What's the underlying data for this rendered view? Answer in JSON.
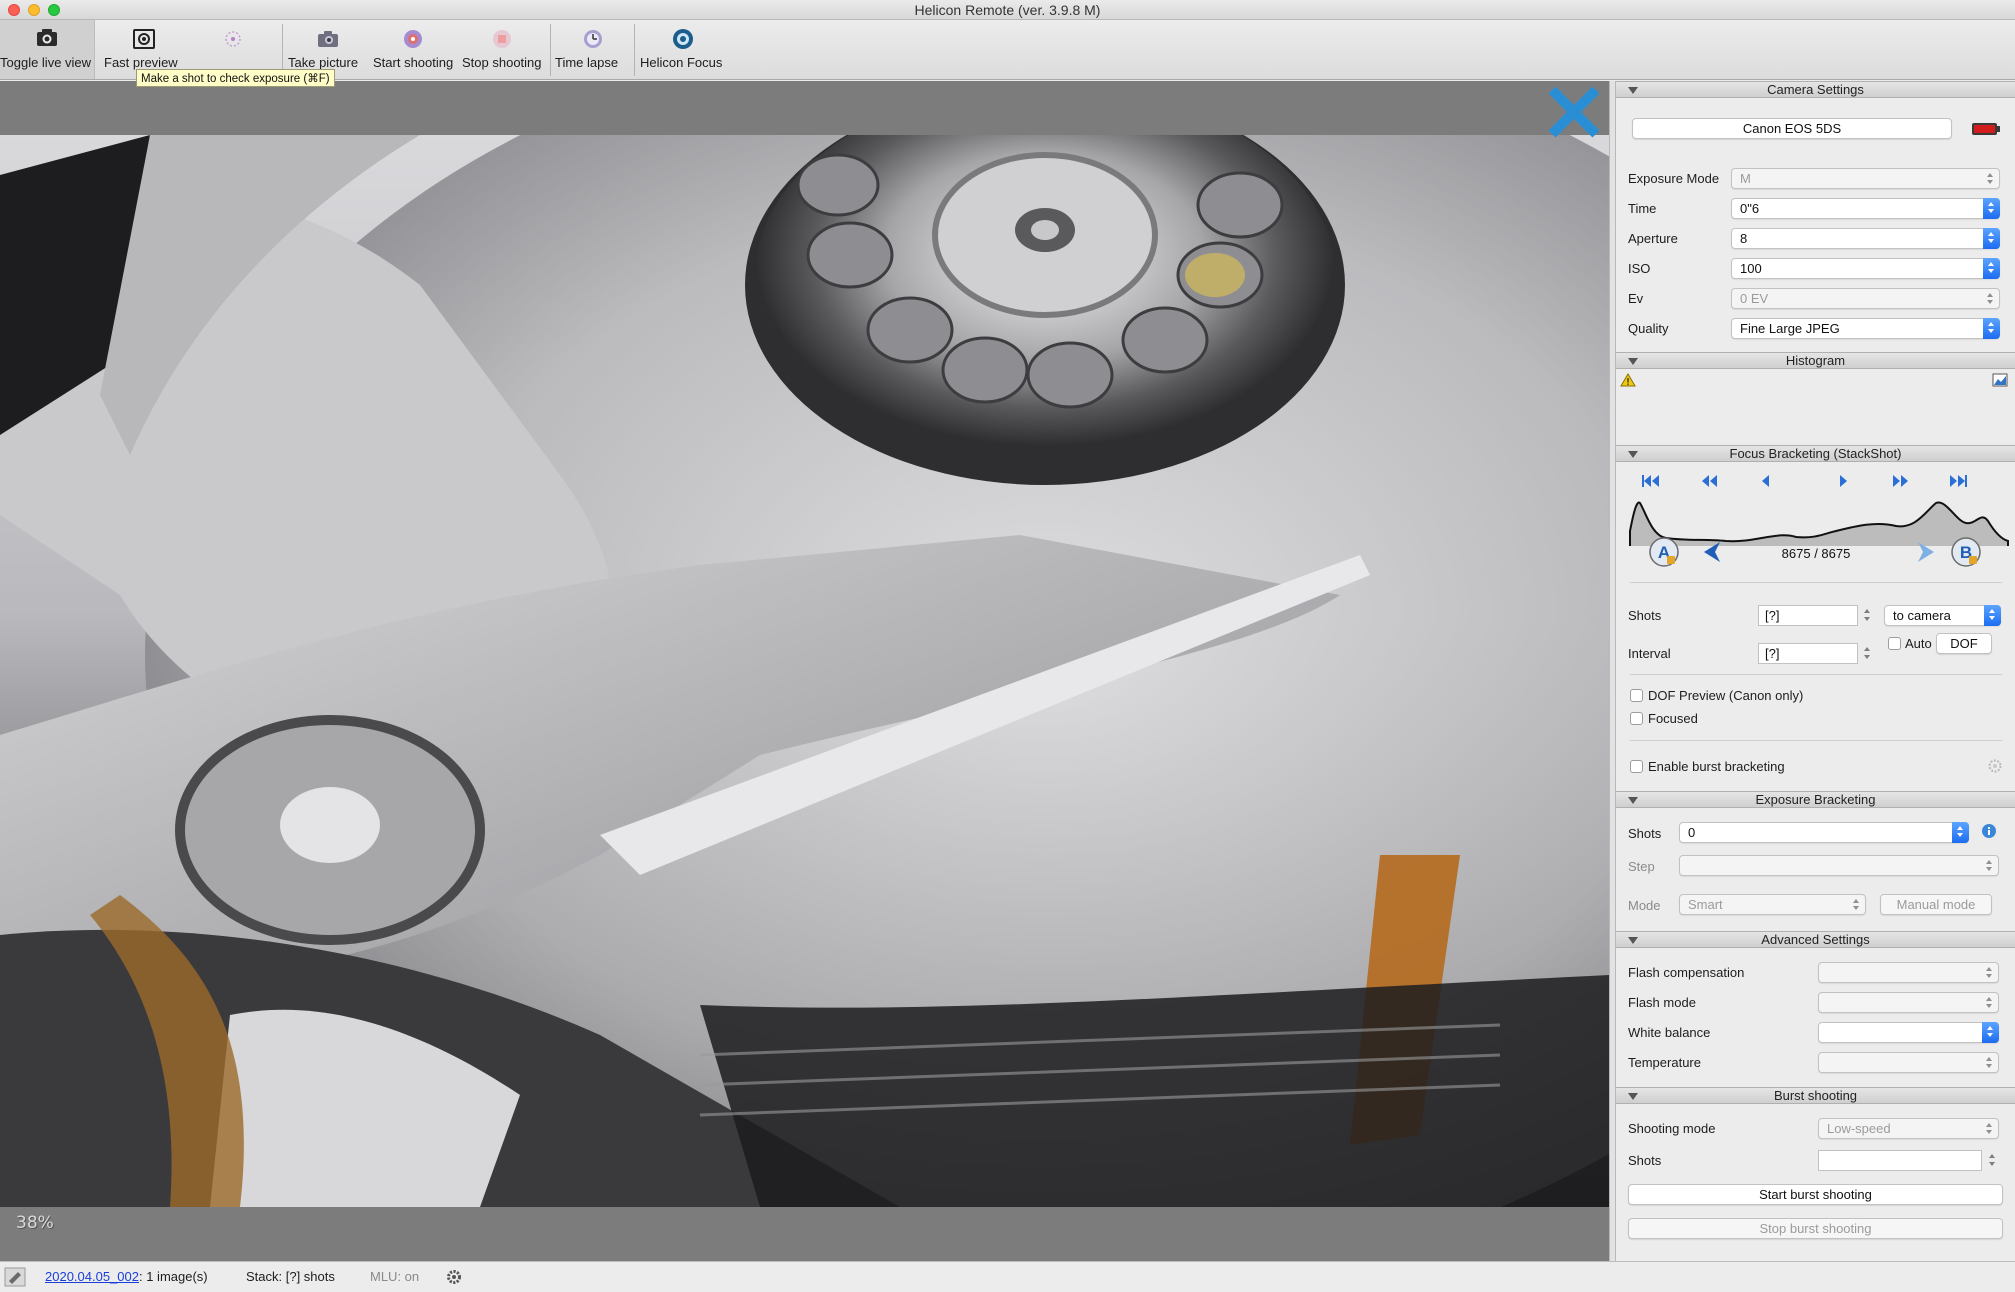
{
  "window": {
    "title": "Helicon Remote (ver. 3.9.8 M)"
  },
  "toolbar": {
    "toggle_live_view": "Toggle live view",
    "fast_preview": "Fast preview",
    "take_picture": "Take picture",
    "start_shooting": "Start shooting",
    "stop_shooting": "Stop shooting",
    "time_lapse": "Time lapse",
    "helicon_focus": "Helicon Focus",
    "tooltip": "Make a shot to check exposure (⌘F)"
  },
  "viewer": {
    "zoom": "38%"
  },
  "camera_settings": {
    "header": "Camera Settings",
    "camera_name": "Canon EOS 5DS",
    "exposure_mode_label": "Exposure Mode",
    "exposure_mode_value": "M",
    "time_label": "Time",
    "time_value": "0\"6",
    "aperture_label": "Aperture",
    "aperture_value": "8",
    "iso_label": "ISO",
    "iso_value": "100",
    "ev_label": "Ev",
    "ev_value": "0 EV",
    "quality_label": "Quality",
    "quality_value": "Fine Large JPEG"
  },
  "histogram": {
    "header": "Histogram"
  },
  "focus_bracketing": {
    "header": "Focus Bracketing (StackShot)",
    "counter": "8675 / 8675",
    "shots_label": "Shots",
    "shots_value": "[?]",
    "destination_value": "to camera",
    "interval_label": "Interval",
    "interval_value": "[?]",
    "auto_label": "Auto",
    "dof_button": "DOF",
    "dof_preview_label": "DOF Preview (Canon only)",
    "focused_label": "Focused",
    "burst_label": "Enable burst bracketing",
    "point_a": "A",
    "point_b": "B"
  },
  "exposure_bracketing": {
    "header": "Exposure Bracketing",
    "shots_label": "Shots",
    "shots_value": "0",
    "step_label": "Step",
    "mode_label": "Mode",
    "mode_value": "Smart",
    "manual_mode_button": "Manual mode"
  },
  "advanced_settings": {
    "header": "Advanced Settings",
    "flash_compensation_label": "Flash compensation",
    "flash_mode_label": "Flash mode",
    "white_balance_label": "White balance",
    "temperature_label": "Temperature"
  },
  "burst_shooting": {
    "header": "Burst shooting",
    "shooting_mode_label": "Shooting mode",
    "shooting_mode_value": "Low-speed",
    "shots_label": "Shots",
    "start_button": "Start burst shooting",
    "stop_button": "Stop burst shooting"
  },
  "statusbar": {
    "session_link": "2020.04.05_002",
    "images_text": ": 1 image(s)",
    "stack_text": "Stack: [?] shots",
    "mlu_text": "MLU: on"
  },
  "colors": {
    "accent_blue": "#1b6cf0",
    "close_blue": "#2a8ed4",
    "link": "#1a3fd8"
  }
}
